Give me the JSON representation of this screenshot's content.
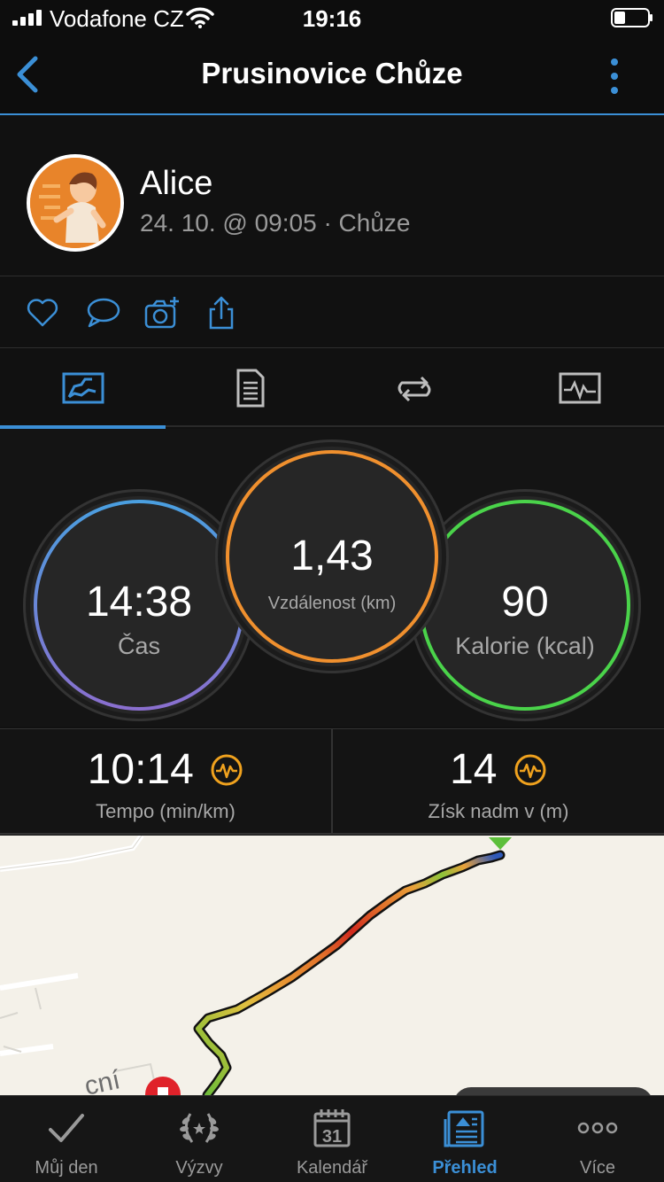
{
  "status_bar": {
    "carrier": "Vodafone CZ",
    "time": "19:16"
  },
  "header": {
    "title": "Prusinovice Chůze"
  },
  "activity": {
    "user_name": "Alice",
    "meta": "24. 10. @ 09:05 · Chůze"
  },
  "stats": {
    "time": {
      "value": "14:38",
      "label": "Čas"
    },
    "distance": {
      "value": "1,43",
      "label": "Vzdálenost (km)"
    },
    "calories": {
      "value": "90",
      "label": "Kalorie (kcal)"
    }
  },
  "metrics": {
    "pace": {
      "value": "10:14",
      "label": "Tempo (min/km)"
    },
    "elevation": {
      "value": "14",
      "label": "Získ nadm v (m)"
    }
  },
  "map": {
    "street_label": "cní"
  },
  "bottom_nav": {
    "items": [
      {
        "label": "Můj den"
      },
      {
        "label": "Výzvy"
      },
      {
        "label": "Kalendář"
      },
      {
        "label": "Přehled"
      },
      {
        "label": "Více"
      }
    ],
    "calendar_day": "31"
  },
  "colors": {
    "accent": "#3b8fd6",
    "time_ring": "#4a8fd8",
    "distance_ring": "#f0902e",
    "calories_ring": "#4ad34a"
  }
}
